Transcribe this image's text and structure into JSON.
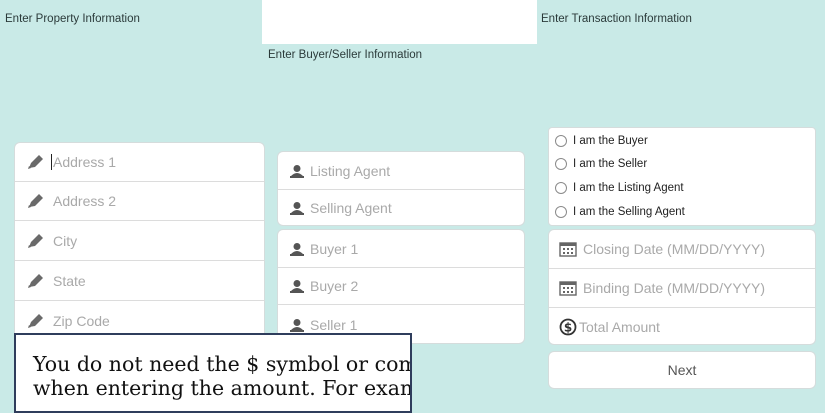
{
  "headers": {
    "property": "Enter Property Information",
    "buyer_seller": "Enter Buyer/Seller Information",
    "transaction": "Enter Transaction Information"
  },
  "property": {
    "fields": [
      {
        "placeholder": "Address 1",
        "icon": "pencil-icon"
      },
      {
        "placeholder": "Address 2",
        "icon": "pencil-icon"
      },
      {
        "placeholder": "City",
        "icon": "pencil-icon"
      },
      {
        "placeholder": "State",
        "icon": "pencil-icon"
      },
      {
        "placeholder": "Zip Code",
        "icon": "pencil-icon"
      }
    ]
  },
  "agents": {
    "listing": "Listing Agent",
    "selling": "Selling Agent"
  },
  "parties": {
    "buyer1": "Buyer 1",
    "buyer2": "Buyer 2",
    "seller1": "Seller 1"
  },
  "role": {
    "options": [
      "I am the Buyer",
      "I am the Seller",
      "I am the Listing Agent",
      "I am the Selling Agent"
    ]
  },
  "transaction": {
    "closing_date": "Closing Date (MM/DD/YYYY)",
    "binding_date": "Binding Date (MM/DD/YYYY)",
    "total_amount": "Total Amount"
  },
  "next_label": "Next",
  "tooltip": {
    "line1": "You do not need the $ symbol or commas",
    "line2": "when entering the amount. For example"
  }
}
